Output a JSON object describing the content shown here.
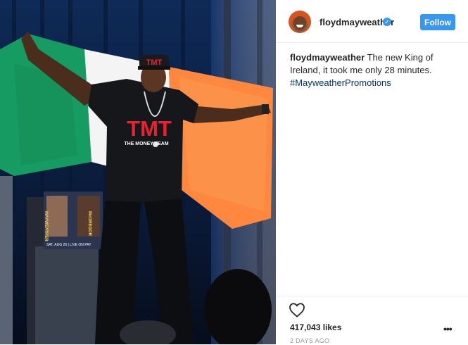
{
  "post": {
    "username": "floydmayweather",
    "follow_label": "Follow",
    "caption_user": "floydmayweather",
    "caption_text": " The new King of Ireland, it took me only 28 minutes.",
    "hashtag": "#MayweatherPromotions",
    "likes": "417,043 likes",
    "time": "2 DAYS AGO",
    "more_label": "•••"
  },
  "photo": {
    "shirt_logo": "TMT",
    "shirt_tagline": "THE MONEY TEAM",
    "cap_logo": "TMT",
    "poster_left": "MAYWEATHER",
    "poster_right": "McGREGOR",
    "poster_bottom": "SAT. AUG 26 | LIVE ON PAY"
  },
  "colors": {
    "accent": "#3897f0",
    "flag_green": "#169b62",
    "flag_white": "#f4f4f4",
    "flag_orange": "#ff883e",
    "hashtag": "#003569"
  },
  "icons": {
    "verified": "verified-badge-icon",
    "like": "heart-icon",
    "more": "more-options-icon"
  }
}
